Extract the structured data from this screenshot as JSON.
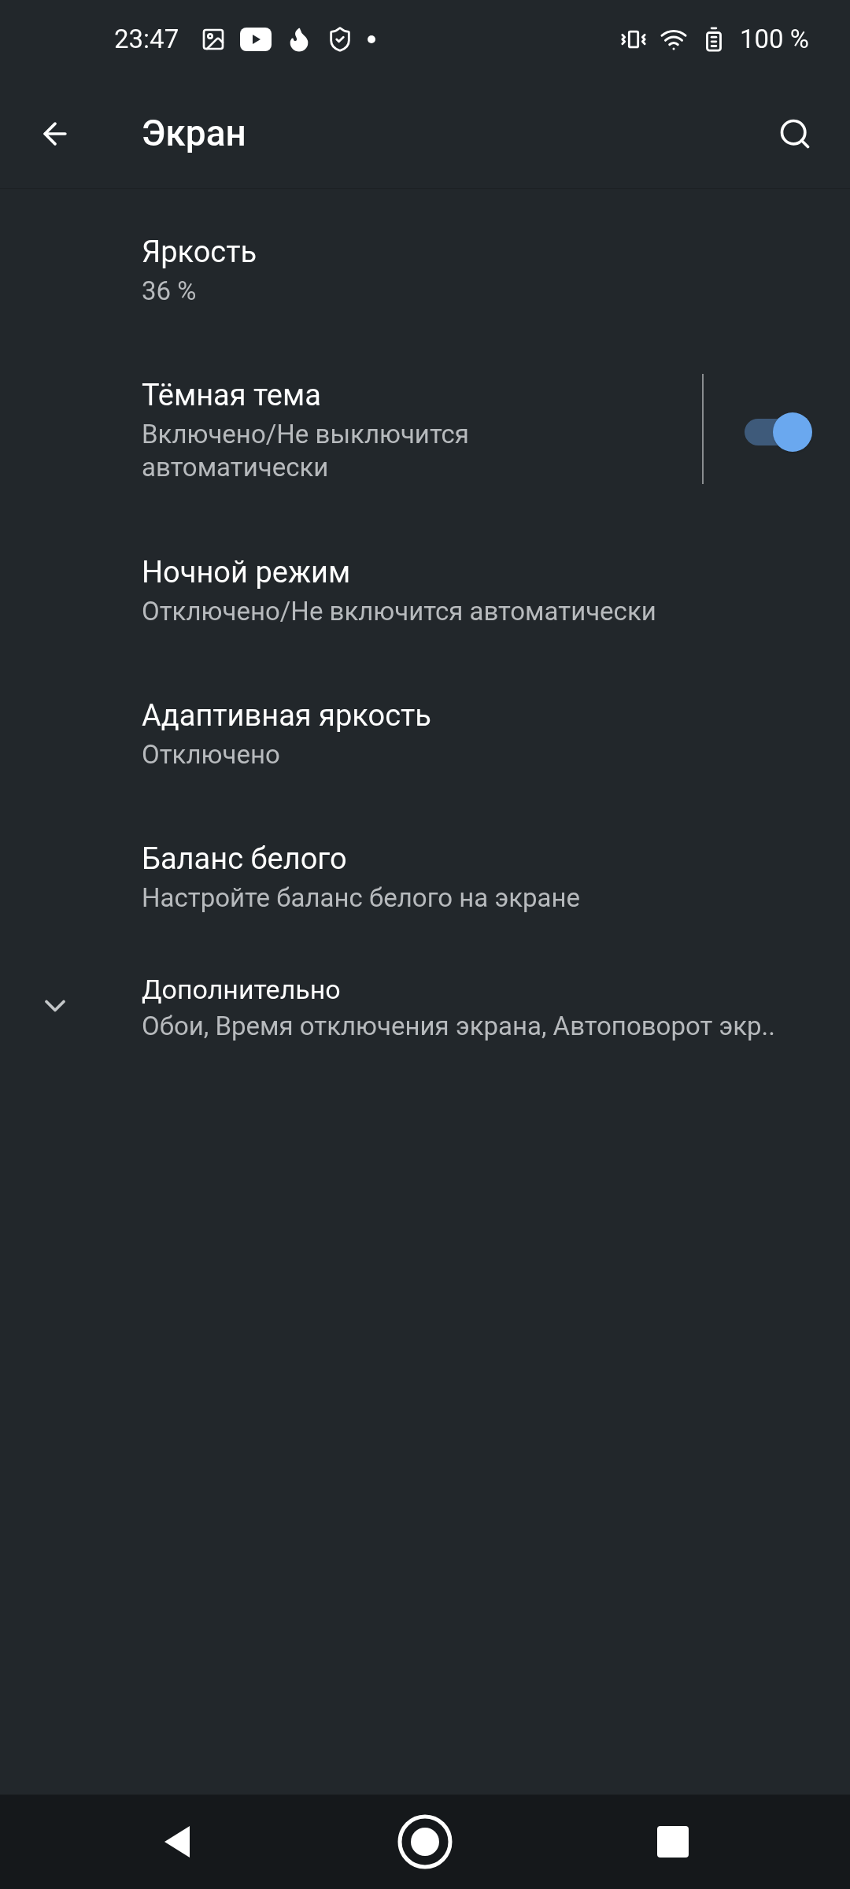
{
  "status_bar": {
    "time": "23:47",
    "battery": "100 %"
  },
  "toolbar": {
    "title": "Экран"
  },
  "items": [
    {
      "kind": "plain",
      "title": "Яркость",
      "summary": "36 %"
    },
    {
      "kind": "toggle",
      "title": "Тёмная тема",
      "summary": "Включено/Не выключится автоматически",
      "on": true
    },
    {
      "kind": "plain",
      "title": "Ночной режим",
      "summary": "Отключено/Не включится автоматически"
    },
    {
      "kind": "plain",
      "title": "Адаптивная яркость",
      "summary": "Отключено"
    },
    {
      "kind": "plain",
      "title": "Баланс белого",
      "summary": "Настройте баланс белого на экране"
    },
    {
      "kind": "expand",
      "title": "Дополнительно",
      "summary": "Обои, Время отключения экрана, Автоповорот экр.."
    }
  ]
}
